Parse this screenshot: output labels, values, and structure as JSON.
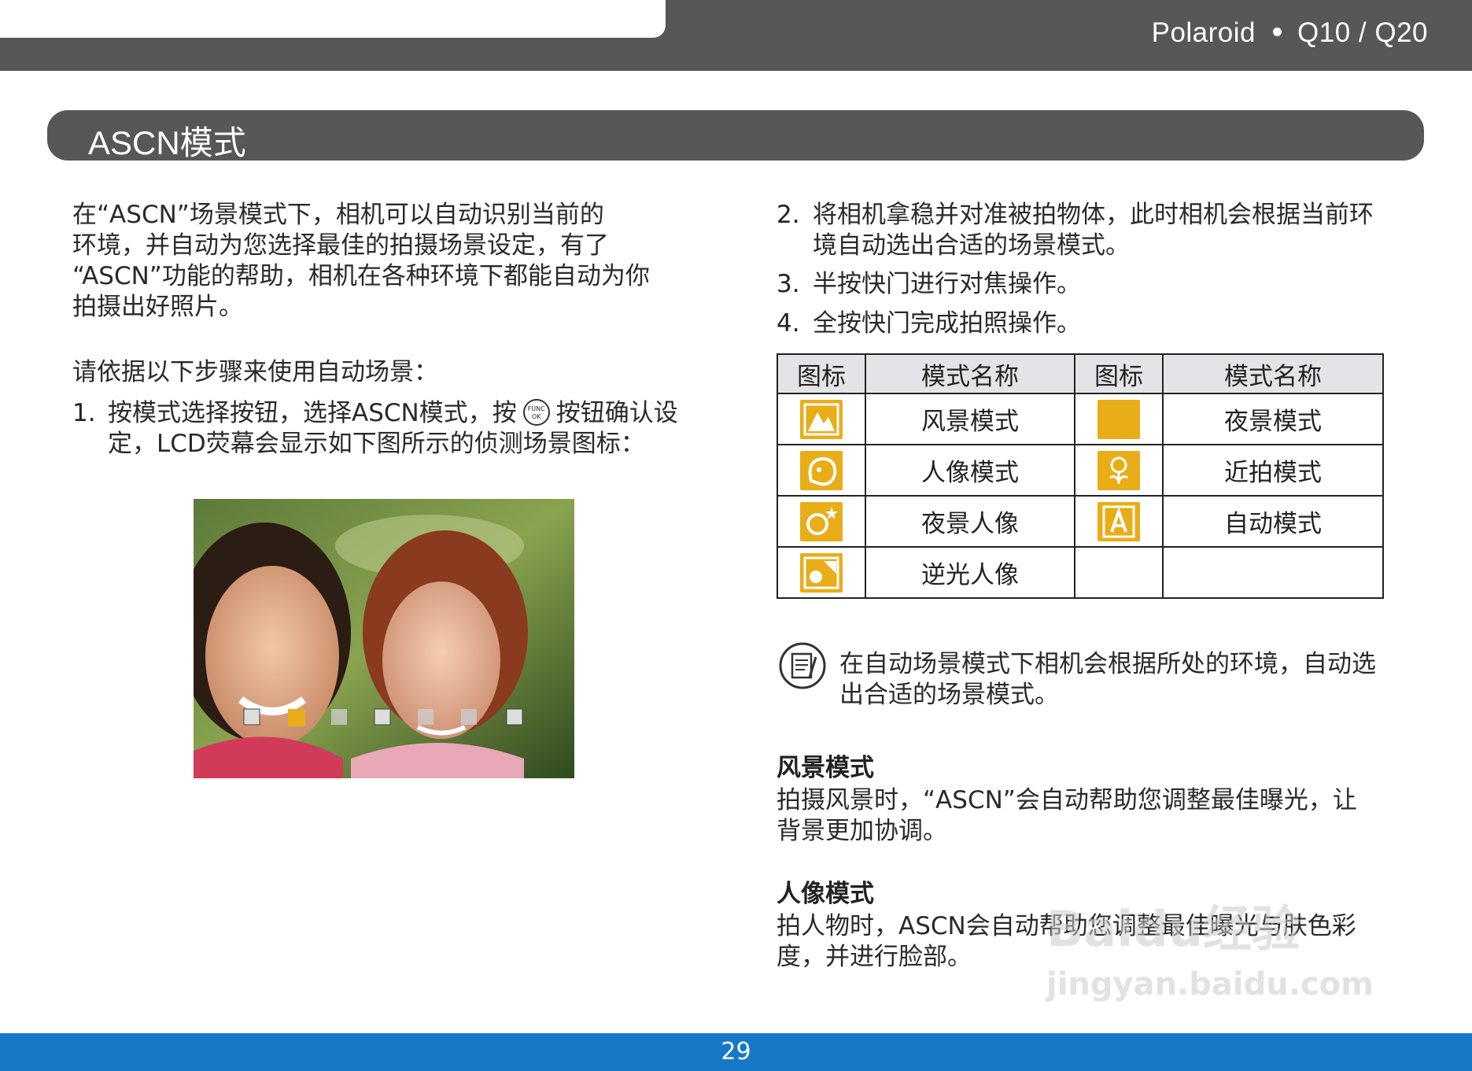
{
  "header": {
    "brand": "Polaroid",
    "model": "Q10 / Q20"
  },
  "title": "ASCN模式",
  "left": {
    "intro": [
      "在“ASCN”场景模式下，相机可以自动识别当前的",
      "环境，并自动为您选择最佳的拍摄场景设定，有了",
      "“ASCN”功能的帮助，相机在各种环境下都能自动为你",
      "拍摄出好照片。"
    ],
    "steps_intro": "请依据以下步骤来使用自动场景：",
    "step1": {
      "num": "1.",
      "line1a": "按模式选择按钮，选择ASCN模式，按",
      "button_icon_text": [
        "FUNC",
        "OK"
      ],
      "line1b": "按钮确认设",
      "line2": "定，LCD荧幕会显示如下图所示的侦测场景图标："
    }
  },
  "right": {
    "steps": [
      {
        "num": "2.",
        "lines": [
          "将相机拿稳并对准被拍物体，此时相机会根据当前环",
          "境自动选出合适的场景模式。"
        ]
      },
      {
        "num": "3.",
        "lines": [
          "半按快门进行对焦操作。"
        ]
      },
      {
        "num": "4.",
        "lines": [
          "全按快门完成拍照操作。"
        ]
      }
    ],
    "table": {
      "headers": [
        "图标",
        "模式名称",
        "图标",
        "模式名称"
      ],
      "rows": [
        {
          "icon1": "landscape-icon",
          "name1": "风景模式",
          "icon2": "night-scene-icon",
          "name2": "夜景模式"
        },
        {
          "icon1": "portrait-icon",
          "name1": "人像模式",
          "icon2": "macro-icon",
          "name2": "近拍模式"
        },
        {
          "icon1": "night-portrait-icon",
          "name1": "夜景人像",
          "icon2": "auto-mode-icon",
          "name2": "自动模式"
        },
        {
          "icon1": "backlight-portrait-icon",
          "name1": "逆光人像",
          "icon2": "",
          "name2": ""
        }
      ]
    },
    "note": [
      "在自动场景模式下相机会根据所处的环境，自动选",
      "出合适的场景模式。"
    ],
    "sections": [
      {
        "heading": "风景模式",
        "lines": [
          "拍摄风景时，“ASCN”会自动帮助您调整最佳曝光，让",
          "背景更加协调。"
        ]
      },
      {
        "heading": "人像模式",
        "lines": [
          "拍人物时，ASCN会自动帮助您调整最佳曝光与肤色彩",
          "度，并进行脸部。"
        ]
      }
    ]
  },
  "watermark": {
    "main": "Baidu经验",
    "sub": "jingyan.baidu.com"
  },
  "footer": {
    "page": "29"
  },
  "colors": {
    "header_gray": "#57575a",
    "footer_blue": "#1679c7",
    "icon_yellow": "#e9ad18"
  }
}
